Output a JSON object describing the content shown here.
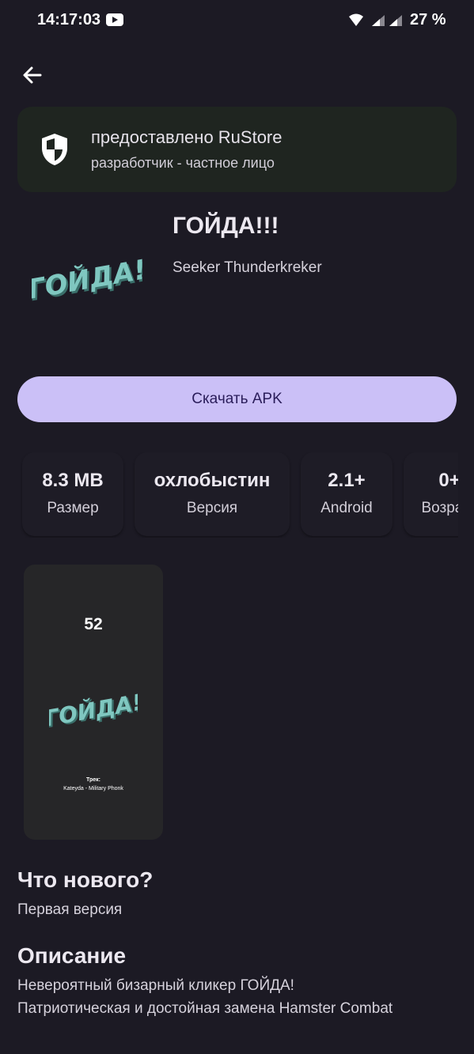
{
  "status_bar": {
    "time": "14:17:03",
    "battery": "27 %",
    "icons": [
      "youtube-icon",
      "wifi-icon",
      "signal-icon",
      "signal-icon"
    ]
  },
  "provider": {
    "title": "предоставлено RuStore",
    "subtitle": "разработчик - частное лицо",
    "icon": "shield-icon"
  },
  "app": {
    "name": "ГОЙДА!!!",
    "developer": "Seeker Thunderkreker",
    "logo_text": "ГОЙДА!"
  },
  "download": {
    "label": "Скачать APK"
  },
  "info_chips": [
    {
      "value": "8.3 MB",
      "label": "Размер"
    },
    {
      "value": "охлобыстин",
      "label": "Версия"
    },
    {
      "value": "2.1+",
      "label": "Android"
    },
    {
      "value": "0+",
      "label": "Возраст"
    }
  ],
  "screenshot": {
    "counter": "52",
    "logo_text": "ГОЙДА!",
    "track_label": "Трек:",
    "track": "Kateyda - Military Phonk"
  },
  "whats_new": {
    "heading": "Что нового?",
    "text": "Первая версия"
  },
  "description": {
    "heading": "Описание",
    "line1": "Невероятный бизарный кликер ГОЙДА!",
    "line2": "Патриотическая и достойная замена Hamster Combat"
  },
  "colors": {
    "background": "#1c1a24",
    "accent_button": "#cbc0f7",
    "logo_teal": "#7fc7c0"
  }
}
